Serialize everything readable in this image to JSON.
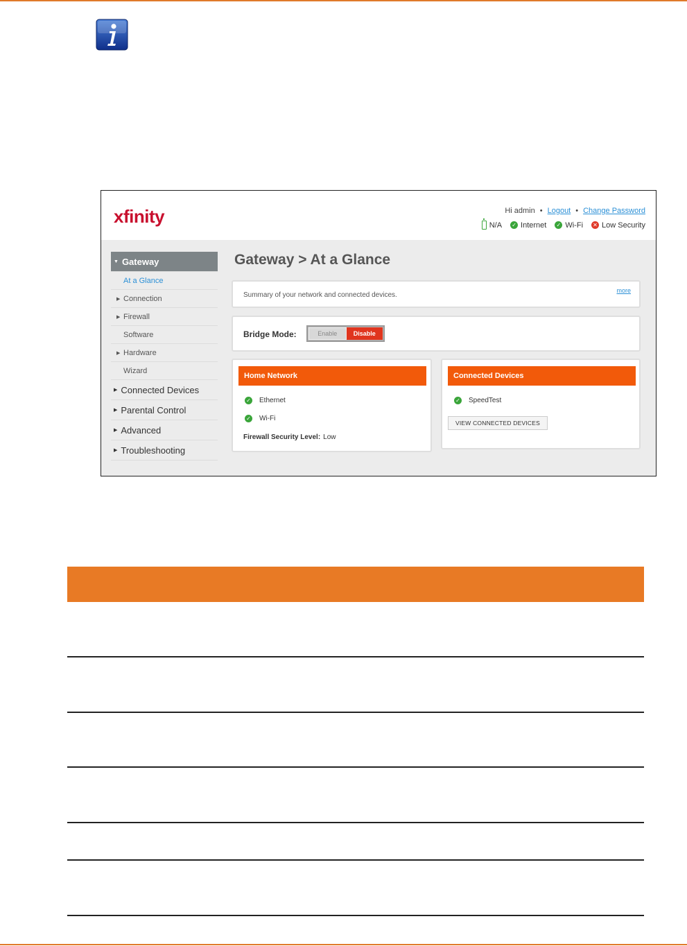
{
  "app": {
    "logo_text": "xfinity"
  },
  "user_bar": {
    "greeting": "Hi admin",
    "separator": "•",
    "logout_label": "Logout",
    "change_password_label": "Change Password"
  },
  "status_bar": {
    "battery_label": "N/A",
    "internet_label": "Internet",
    "wifi_label": "Wi-Fi",
    "security_label": "Low Security"
  },
  "sidebar": {
    "gateway_label": "Gateway",
    "sub_items": [
      {
        "label": "At a Glance"
      },
      {
        "label": "Connection"
      },
      {
        "label": "Firewall"
      },
      {
        "label": "Software"
      },
      {
        "label": "Hardware"
      },
      {
        "label": "Wizard"
      }
    ],
    "main_items": [
      {
        "label": "Connected Devices"
      },
      {
        "label": "Parental Control"
      },
      {
        "label": "Advanced"
      },
      {
        "label": "Troubleshooting"
      }
    ]
  },
  "main": {
    "page_title": "Gateway > At a Glance",
    "summary_text": "Summary of your network and connected devices.",
    "more_link": "more",
    "bridge_mode": {
      "label": "Bridge Mode:",
      "enable_label": "Enable",
      "disable_label": "Disable"
    },
    "home_network": {
      "title": "Home Network",
      "ethernet_label": "Ethernet",
      "wifi_label": "Wi-Fi",
      "firewall_label": "Firewall Security Level:",
      "firewall_value": "Low"
    },
    "connected_devices": {
      "title": "Connected Devices",
      "speedtest_label": "SpeedTest",
      "view_button_label": "VIEW CONNECTED DEVICES"
    }
  },
  "colors": {
    "accent_orange": "#f25a0a",
    "doc_orange": "#e87a25",
    "brand_red": "#c8102e",
    "ok_green": "#3aa53a",
    "error_red": "#e03a2a",
    "link_blue": "#2a8fd6"
  },
  "icons": {
    "info": "info-icon",
    "check": "check-circle-icon",
    "error": "x-circle-icon",
    "battery": "battery-icon"
  }
}
